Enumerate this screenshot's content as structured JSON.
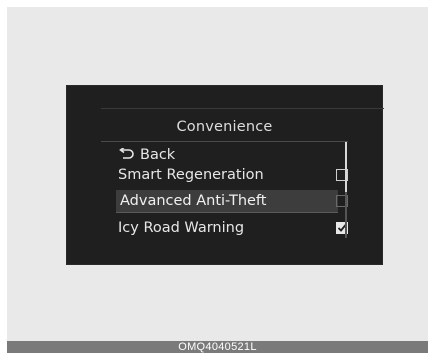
{
  "menu": {
    "title": "Convenience",
    "back_label": "Back",
    "items": [
      {
        "label": "Smart Regeneration",
        "checked": false,
        "selected": false
      },
      {
        "label": "Advanced Anti-Theft",
        "checked": false,
        "selected": true
      },
      {
        "label": "Icy Road Warning",
        "checked": true,
        "selected": false
      }
    ]
  },
  "caption": "OMQ4040521L",
  "colors": {
    "screen_background": "#1f1f1f",
    "highlight": "#3d3d3d",
    "text": "#e6e6e6"
  },
  "icons": {
    "back": "return-arrow-icon",
    "check": "checkmark-icon"
  }
}
